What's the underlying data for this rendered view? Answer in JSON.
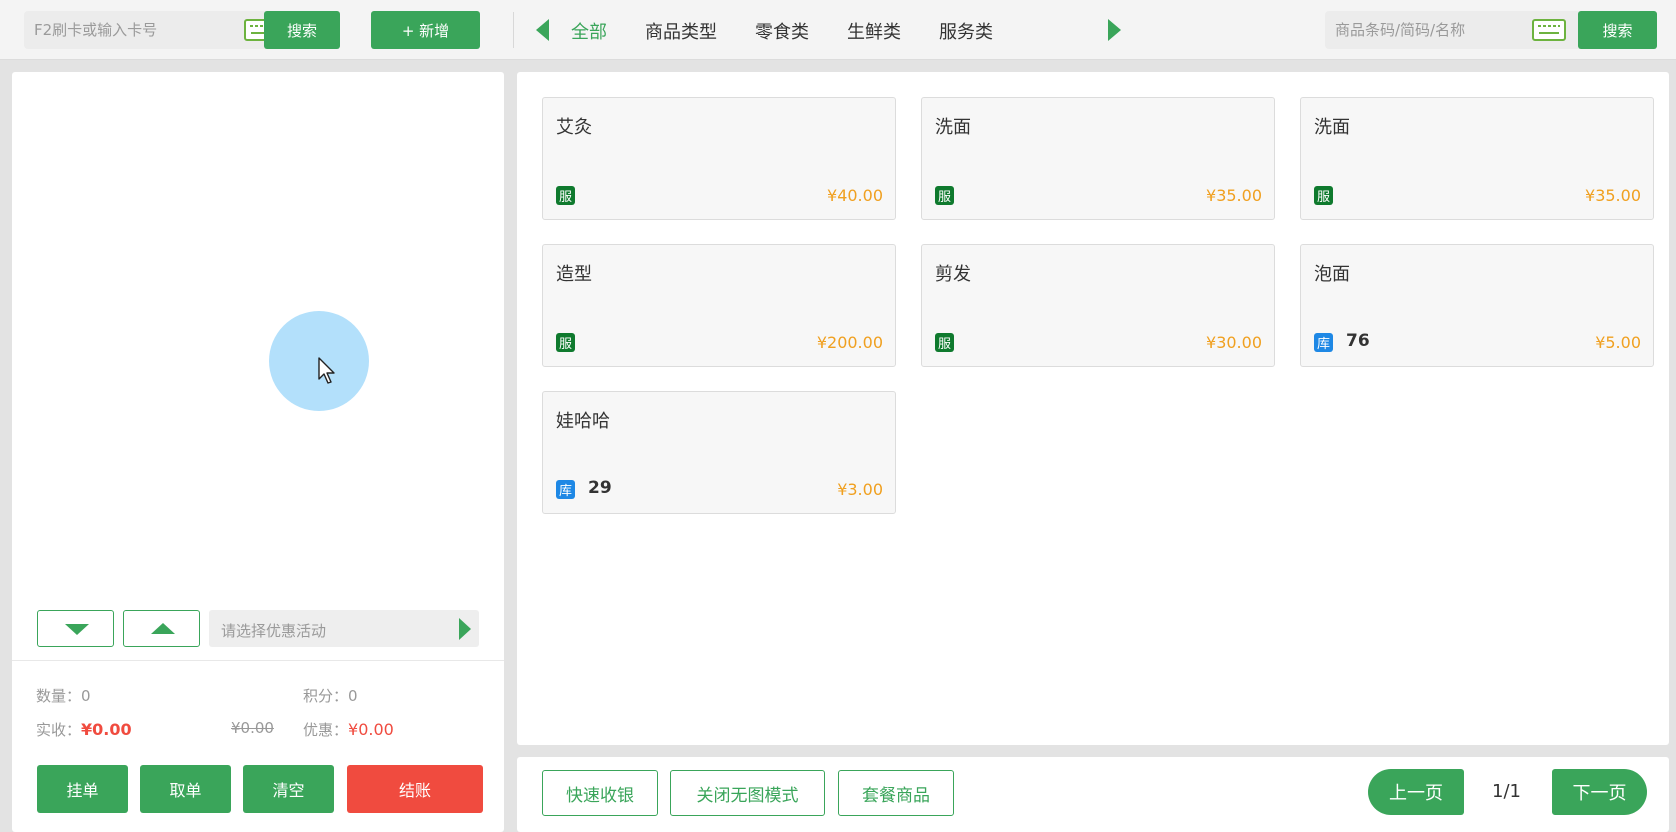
{
  "topbar": {
    "card_search": {
      "placeholder": "F2刷卡或输入卡号",
      "button": "搜索"
    },
    "add_button": "+ 新增",
    "categories": [
      {
        "label": "全部",
        "active": true
      },
      {
        "label": "商品类型",
        "active": false
      },
      {
        "label": "零食类",
        "active": false
      },
      {
        "label": "生鲜类",
        "active": false
      },
      {
        "label": "服务类",
        "active": false
      }
    ],
    "product_search": {
      "placeholder": "商品条码/简码/名称",
      "button": "搜索"
    }
  },
  "cart": {
    "promo_placeholder": "请选择优惠活动",
    "summary": {
      "qty_label": "数量：",
      "qty_value": "0",
      "points_label": "积分：",
      "points_value": "0",
      "paid_label": "实收：",
      "paid_value": "¥0.00",
      "original_value": "¥0.00",
      "discount_label": "优惠：",
      "discount_value": "¥0.00"
    },
    "actions": {
      "hold": "挂单",
      "retrieve": "取单",
      "clear": "清空",
      "checkout": "结账"
    }
  },
  "products": [
    {
      "name": "艾灸",
      "tag": "服",
      "tag_type": "service",
      "stock": "",
      "price": "¥40.00"
    },
    {
      "name": "洗面",
      "tag": "服",
      "tag_type": "service",
      "stock": "",
      "price": "¥35.00"
    },
    {
      "name": "洗面",
      "tag": "服",
      "tag_type": "service",
      "stock": "",
      "price": "¥35.00"
    },
    {
      "name": "造型",
      "tag": "服",
      "tag_type": "service",
      "stock": "",
      "price": "¥200.00"
    },
    {
      "name": "剪发",
      "tag": "服",
      "tag_type": "service",
      "stock": "",
      "price": "¥30.00"
    },
    {
      "name": "泡面",
      "tag": "库",
      "tag_type": "stock",
      "stock": "76",
      "price": "¥5.00"
    },
    {
      "name": "娃哈哈",
      "tag": "库",
      "tag_type": "stock",
      "stock": "29",
      "price": "¥3.00"
    }
  ],
  "bottom": {
    "quick_checkout": "快速收银",
    "toggle_image_mode": "关闭无图模式",
    "bundle_goods": "套餐商品",
    "prev_page": "上一页",
    "page_indicator": "1/1",
    "next_page": "下一页"
  },
  "colors": {
    "accent": "#3aa55a",
    "checkout": "#f04b3f",
    "price": "#f0a020",
    "service_tag": "#0f7a2e",
    "stock_tag": "#1e88e5"
  }
}
